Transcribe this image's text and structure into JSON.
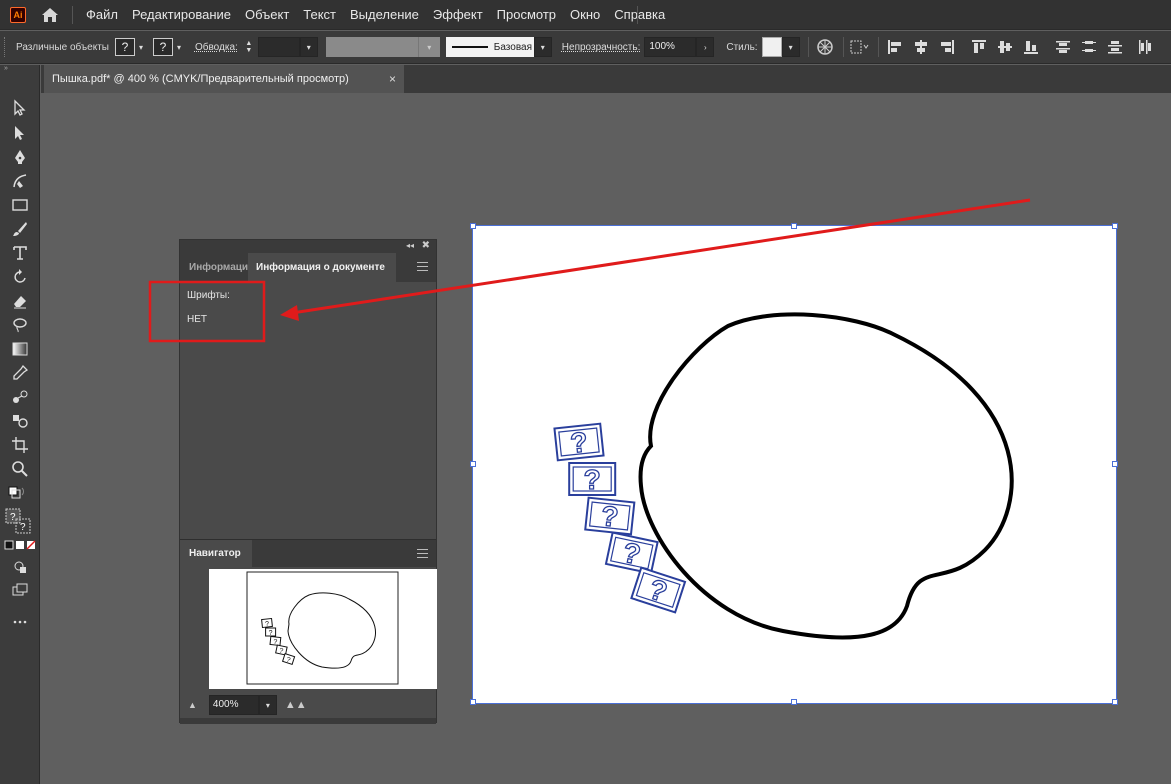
{
  "app": {
    "logo_text": "Ai"
  },
  "menu": {
    "items": [
      "Файл",
      "Редактирование",
      "Объект",
      "Текст",
      "Выделение",
      "Эффект",
      "Просмотр",
      "Окно",
      "Справка"
    ]
  },
  "control_bar": {
    "selection_label": "Различные объекты",
    "fill_value": "?",
    "stroke_value": "?",
    "stroke_label": "Обводка:",
    "stroke_profile": "Базовая",
    "opacity_label": "Непрозрачность:",
    "opacity_value": "100%",
    "style_label": "Стиль:"
  },
  "document_tab": {
    "title": "Пышка.pdf* @ 400 % (CMYK/Предварительный просмотр)",
    "close": "×"
  },
  "doc_info_panel": {
    "tab_inactive": "Информация",
    "tab_active": "Информация о документе",
    "fonts_label": "Шрифты:",
    "fonts_value": "НЕТ"
  },
  "navigator_panel": {
    "tab": "Навигатор",
    "zoom_value": "400%"
  },
  "artwork": {
    "placeholder_glyph": "?",
    "placeholder_count": 5
  },
  "annotation": {
    "highlight_color": "#e01b1b",
    "arrow_color": "#e01b1b"
  },
  "colors": {
    "selection": "#4a6fd6",
    "placeholder_blue": "#2a3f9c"
  }
}
